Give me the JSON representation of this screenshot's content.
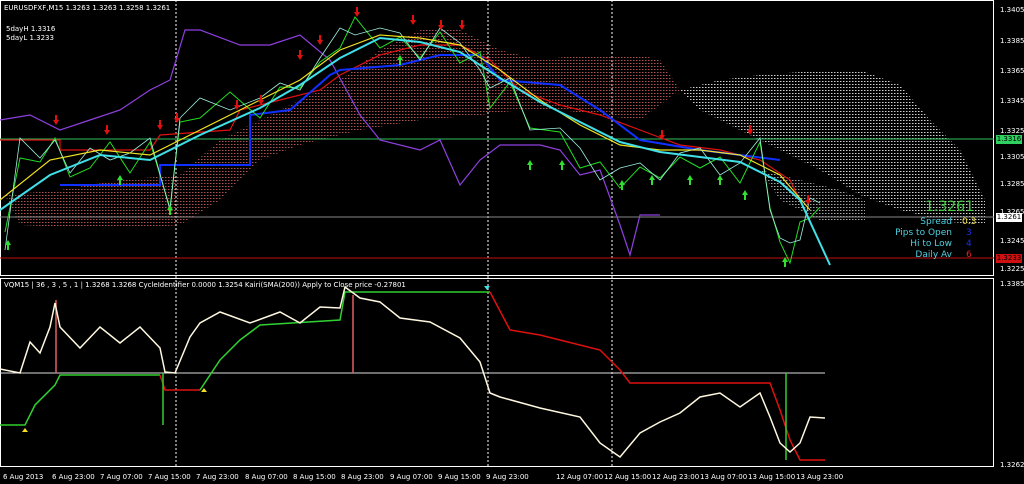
{
  "header": {
    "symbol_line": "EURUSDFXF,M15  1.3263 1.3263 1.3258 1.3261",
    "day_high": "5dayH 1.3316",
    "day_low": "5dayL 1.3233"
  },
  "price_axis": [
    "1.3405",
    "1.3385",
    "1.3365",
    "1.3345",
    "1.3325",
    "1.3305",
    "1.3285",
    "1.3265",
    "1.3245",
    "1.3225"
  ],
  "price_tags": {
    "high": "1.3316",
    "current": "1.3261",
    "low": "1.3233"
  },
  "info_panel": {
    "price": "1.3261",
    "rows": [
      {
        "label": "Spread",
        "value": "0.3",
        "color": "#f0e040"
      },
      {
        "label": "Pips to Open",
        "value": "3",
        "color": "#2030e0"
      },
      {
        "label": "Hi to Low",
        "value": "4",
        "color": "#2030e0"
      },
      {
        "label": "Daily Av",
        "value": "6",
        "color": "#e02020"
      }
    ]
  },
  "indicator": {
    "title": "VQM15 | 36 , 3 , 5 , 1 |  1.3268 1.3268  CycleIdentifier 0.0000 1.3254  Kairi(SMA(200)) Apply to Close price -0.27801",
    "axis_top": "1.3385",
    "axis_bottom": "1.3262"
  },
  "time_axis": [
    "6 Aug 2013",
    "6 Aug 23:00",
    "7 Aug 07:00",
    "7 Aug 15:00",
    "7 Aug 23:00",
    "8 Aug 07:00",
    "8 Aug 15:00",
    "8 Aug 23:00",
    "9 Aug 07:00",
    "9 Aug 15:00",
    "9 Aug 23:00",
    "12 Aug 07:00",
    "12 Aug 15:00",
    "12 Aug 23:00",
    "13 Aug 07:00",
    "13 Aug 15:00",
    "13 Aug 23:00"
  ],
  "colors": {
    "price": "#22dd22",
    "cyan": "#40e0e8",
    "purple": "#9040e0",
    "blue": "#1030ff",
    "red": "#e01010",
    "yellow": "#f0e020",
    "cloud": "#a04040"
  }
}
